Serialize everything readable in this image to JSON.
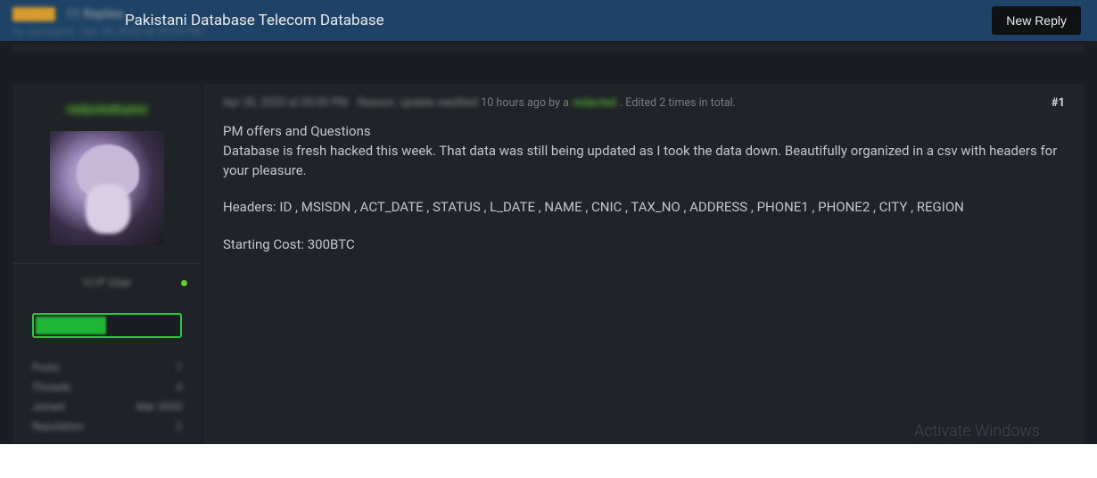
{
  "header": {
    "title": "Pakistani Database Telecom Database",
    "reply_button": "New Reply"
  },
  "top_blur": {
    "badge": "ONLINE",
    "thread_count": "11 Replies",
    "subline": "by username · Apr 30, 2020 at 09:00 PM"
  },
  "sidebar": {
    "username": "redactedname",
    "rank": "V.I.P User",
    "stats": [
      {
        "label": "Posts",
        "value": "7"
      },
      {
        "label": "Threads",
        "value": "4"
      },
      {
        "label": "Joined",
        "value": "Mar 2020"
      },
      {
        "label": "Reputation",
        "value": "2"
      }
    ]
  },
  "post": {
    "meta_date_blur": "Apr 30, 2020 at 09:00 PM ·",
    "meta_reason_blur": "Reason: update reedited",
    "meta_time": "10 hours ago by a",
    "meta_user_blur": "redacted",
    "meta_edit": ". Edited 2 times in total.",
    "number": "#1",
    "line1": "PM offers and Questions",
    "line2": "Database is fresh hacked this week. That data was still being updated as I took the data down. Beautifully organized in a csv with headers for your pleasure.",
    "line3": "Headers: ID , MSISDN , ACT_DATE , STATUS , L_DATE , NAME , CNIC , TAX_NO , ADDRESS , PHONE1 , PHONE2 , CITY , REGION",
    "line4": "Starting Cost: 300BTC"
  },
  "watermark": "Activate Windows"
}
